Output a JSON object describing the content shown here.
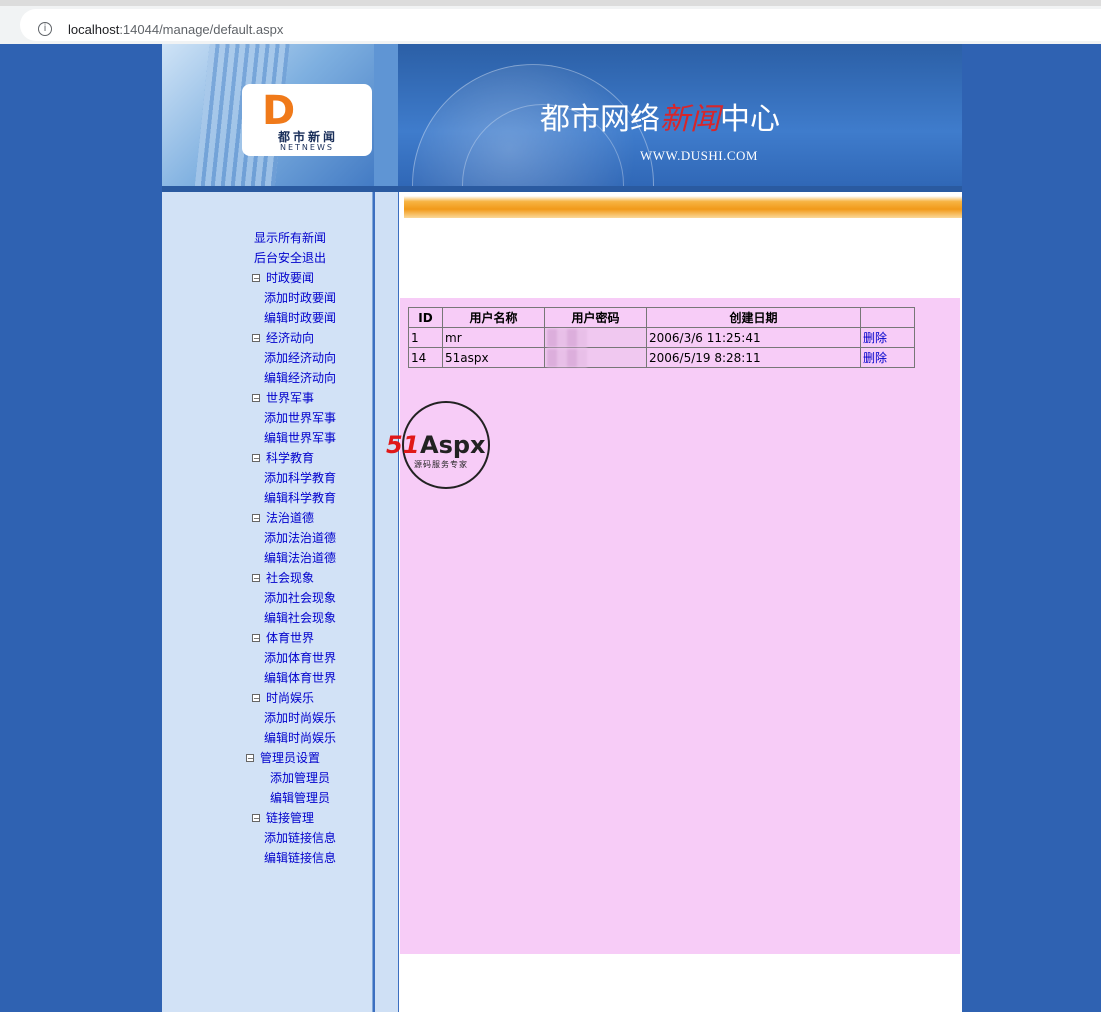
{
  "browser": {
    "url_host": "localhost",
    "url_rest": ":14044/manage/default.aspx"
  },
  "header": {
    "logo_mark": "D",
    "logo_cn": "都市新闻",
    "logo_en": "NETNEWS",
    "title_part1": "都市网络",
    "title_accent": "新闻",
    "title_part2": "中心",
    "site_url": "WWW.DUSHI.COM"
  },
  "nav": {
    "show_all": "显示所有新闻",
    "logout": "后台安全退出",
    "sections": [
      {
        "label": "时政要闻",
        "add": "添加时政要闻",
        "edit": "编辑时政要闻"
      },
      {
        "label": "经济动向",
        "add": "添加经济动向",
        "edit": "编辑经济动向"
      },
      {
        "label": "世界军事",
        "add": "添加世界军事",
        "edit": "编辑世界军事"
      },
      {
        "label": "科学教育",
        "add": "添加科学教育",
        "edit": "编辑科学教育"
      },
      {
        "label": "法治道德",
        "add": "添加法治道德",
        "edit": "编辑法治道德"
      },
      {
        "label": "社会现象",
        "add": "添加社会现象",
        "edit": "编辑社会现象"
      },
      {
        "label": "体育世界",
        "add": "添加体育世界",
        "edit": "编辑体育世界"
      },
      {
        "label": "时尚娱乐",
        "add": "添加时尚娱乐",
        "edit": "编辑时尚娱乐"
      },
      {
        "label": "管理员设置",
        "add": "添加管理员",
        "edit": "编辑管理员"
      },
      {
        "label": "链接管理",
        "add": "添加链接信息",
        "edit": "编辑链接信息"
      }
    ]
  },
  "table": {
    "headers": [
      "ID",
      "用户名称",
      "用户密码",
      "创建日期",
      ""
    ],
    "rows": [
      {
        "id": "1",
        "name": "mr",
        "date": "2006/3/6 11:25:41",
        "action": "删除"
      },
      {
        "id": "14",
        "name": "51aspx",
        "date": "2006/5/19 8:28:11",
        "action": "删除"
      }
    ]
  },
  "watermark": {
    "brand_red": "51",
    "brand_dark": "Aspx",
    "tagline": "源码服务专家"
  },
  "colors": {
    "page_bg": "#2f62b2",
    "sidebar_bg": "#d2e2f6",
    "content_pink": "#f7ccf7",
    "link": "#0000cc",
    "orange": "#f19a1a"
  }
}
